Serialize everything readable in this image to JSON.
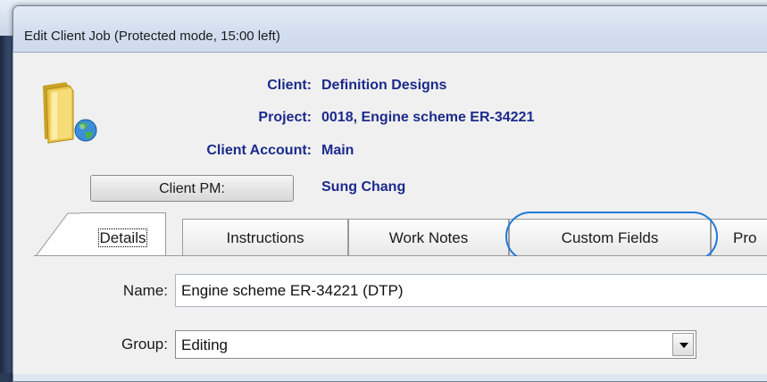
{
  "window": {
    "title": "Edit Client Job (Protected mode, 15:00 left)"
  },
  "header": {
    "client_label": "Client:",
    "client_value": "Definition Designs",
    "project_label": "Project:",
    "project_value": "0018, Engine scheme ER-34221",
    "account_label": "Client Account:",
    "account_value": "Main",
    "pm_button_label": "Client PM:",
    "pm_value": "Sung Chang",
    "icon": "folder-globe-icon"
  },
  "tabs": [
    {
      "label": "Details",
      "active": true
    },
    {
      "label": "Instructions",
      "active": false
    },
    {
      "label": "Work Notes",
      "active": false
    },
    {
      "label": "Custom Fields",
      "active": false,
      "highlighted": true
    },
    {
      "label": "Pro",
      "active": false
    }
  ],
  "form": {
    "name_label": "Name:",
    "name_value": "Engine scheme ER-34221 (DTP)",
    "group_label": "Group:",
    "group_value": "Editing"
  },
  "colors": {
    "header_text": "#1c2a8c",
    "highlight": "#1f7ad8",
    "titlebar": "#d2def0"
  }
}
